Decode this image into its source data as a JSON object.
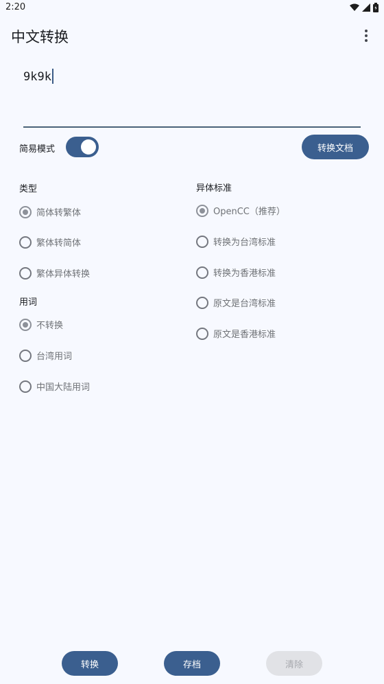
{
  "status": {
    "time": "2:20"
  },
  "app": {
    "title": "中文转换"
  },
  "input": {
    "value": "9k9k"
  },
  "simple_mode": {
    "label": "简易模式",
    "on": true
  },
  "doc_button": "转换文档",
  "type_section": {
    "title": "类型",
    "options": [
      {
        "label": "简体转繁体",
        "checked": true
      },
      {
        "label": "繁体转简体",
        "checked": false
      },
      {
        "label": "繁体异体转换",
        "checked": false
      }
    ]
  },
  "words_section": {
    "title": "用词",
    "options": [
      {
        "label": "不转换",
        "checked": true
      },
      {
        "label": "台湾用词",
        "checked": false
      },
      {
        "label": "中国大陆用词",
        "checked": false
      }
    ]
  },
  "variant_section": {
    "title": "异体标准",
    "options": [
      {
        "label": "OpenCC（推荐）",
        "checked": true
      },
      {
        "label": "转换为台湾标准",
        "checked": false
      },
      {
        "label": "转换为香港标准",
        "checked": false
      },
      {
        "label": "原文是台湾标准",
        "checked": false
      },
      {
        "label": "原文是香港标准",
        "checked": false
      }
    ]
  },
  "bottom": {
    "convert": "转换",
    "save": "存档",
    "clear": "清除"
  },
  "colors": {
    "accent": "#3b5f8f",
    "background": "#f7f9ff"
  }
}
